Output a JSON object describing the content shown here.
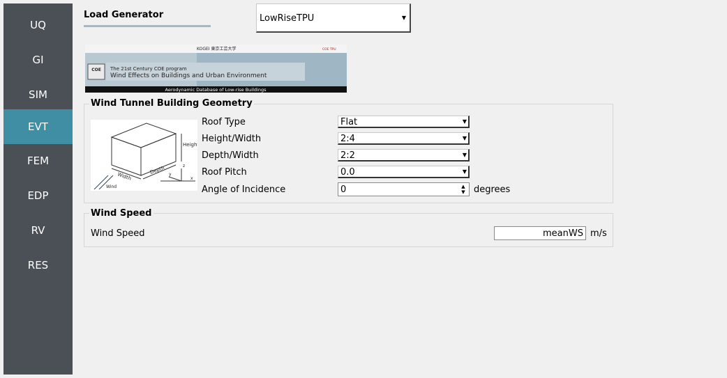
{
  "sidebar": {
    "items": [
      {
        "label": "UQ",
        "active": false
      },
      {
        "label": "GI",
        "active": false
      },
      {
        "label": "SIM",
        "active": false
      },
      {
        "label": "EVT",
        "active": true
      },
      {
        "label": "FEM",
        "active": false
      },
      {
        "label": "EDP",
        "active": false
      },
      {
        "label": "RV",
        "active": false
      },
      {
        "label": "RES",
        "active": false
      }
    ]
  },
  "load_generator": {
    "label": "Load Generator",
    "selected": "LowRiseTPU"
  },
  "banner": {
    "header_logo": "KOGEI 東京工芸大学",
    "header_right": "COE TPU",
    "subtitle": "The 21st Century COE program",
    "title": "Wind Effects on Buildings and Urban Environment",
    "footer": "Aerodynamic Database of Low-rise Buildings",
    "coe_badge": "COE"
  },
  "geometry": {
    "title": "Wind Tunnel Building Geometry",
    "image_labels": {
      "height": "Height",
      "width": "Width",
      "depth": "Depth",
      "wind": "Wind",
      "x": "x",
      "y": "y",
      "z": "z"
    },
    "fields": [
      {
        "label": "Roof Type",
        "value": "Flat"
      },
      {
        "label": "Height/Width",
        "value": "2:4"
      },
      {
        "label": "Depth/Width",
        "value": "2:2"
      },
      {
        "label": "Roof Pitch",
        "value": "0.0"
      }
    ],
    "angle": {
      "label": "Angle of Incidence",
      "value": "0",
      "unit": "degrees"
    }
  },
  "wind_speed": {
    "title": "Wind Speed",
    "label": "Wind Speed",
    "value": "meanWS",
    "unit": "m/s"
  },
  "colors": {
    "sidebar_bg": "#4a5056",
    "sidebar_active": "#3f8ea4"
  }
}
